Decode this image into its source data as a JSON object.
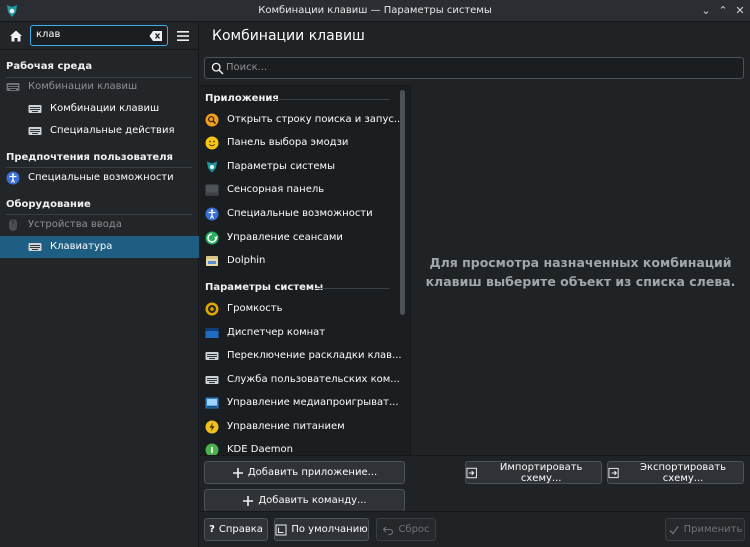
{
  "window": {
    "title": "Комбинации клавиш — Параметры системы"
  },
  "sidebar": {
    "search_value": "клав",
    "sections": [
      {
        "title": "Рабочая среда"
      },
      {
        "title": "Предпочтения пользователя"
      },
      {
        "title": "Оборудование"
      }
    ],
    "items": [
      {
        "label": "Комбинации клавиш",
        "icon": "keyboard-icon",
        "dim": true
      },
      {
        "label": "Комбинации клавиш",
        "icon": "keyboard-icon"
      },
      {
        "label": "Специальные действия",
        "icon": "keyboard-icon"
      },
      {
        "label": "Специальные возможности",
        "icon": "accessibility-icon"
      },
      {
        "label": "Устройства ввода",
        "icon": "input-devices-icon",
        "dim": true
      },
      {
        "label": "Клавиатура",
        "icon": "keyboard-icon",
        "selected": true
      }
    ]
  },
  "main": {
    "title": "Комбинации клавиш",
    "search_placeholder": "Поиск...",
    "groups": [
      {
        "title": "Приложения",
        "items": [
          {
            "label": "Открыть строку поиска и запус...",
            "icon": "krunner-icon"
          },
          {
            "label": "Панель выбора эмодзи",
            "icon": "emoji-icon"
          },
          {
            "label": "Параметры системы",
            "icon": "system-settings-icon"
          },
          {
            "label": "Сенсорная панель",
            "icon": "touchpad-icon"
          },
          {
            "label": "Специальные возможности",
            "icon": "accessibility-icon"
          },
          {
            "label": "Управление сеансами",
            "icon": "session-icon"
          },
          {
            "label": "Dolphin",
            "icon": "dolphin-icon"
          }
        ]
      },
      {
        "title": "Параметры системы",
        "items": [
          {
            "label": "Громкость",
            "icon": "volume-icon"
          },
          {
            "label": "Диспетчер комнат",
            "icon": "activity-manager-icon"
          },
          {
            "label": "Переключение раскладки клав...",
            "icon": "keyboard-icon"
          },
          {
            "label": "Служба пользовательских ком...",
            "icon": "keyboard-icon"
          },
          {
            "label": "Управление медиапроигрыват...",
            "icon": "media-player-icon"
          },
          {
            "label": "Управление питанием",
            "icon": "power-icon"
          },
          {
            "label": "KDE Daemon",
            "icon": "kde-daemon-icon"
          }
        ]
      }
    ],
    "detail_message_line1": "Для просмотра назначенных комбинаций",
    "detail_message_line2": "клавиш выберите объект из списка слева."
  },
  "buttons": {
    "add_app": "Добавить приложение...",
    "add_command": "Добавить команду...",
    "import_scheme": "Импортировать схему...",
    "export_scheme": "Экспортировать схему...",
    "help": "Справка",
    "defaults": "По умолчанию",
    "reset": "Сброс",
    "apply": "Применить"
  },
  "colors": {
    "accent": "#3daee9",
    "selection": "#1e5e83",
    "background": "#202326"
  }
}
